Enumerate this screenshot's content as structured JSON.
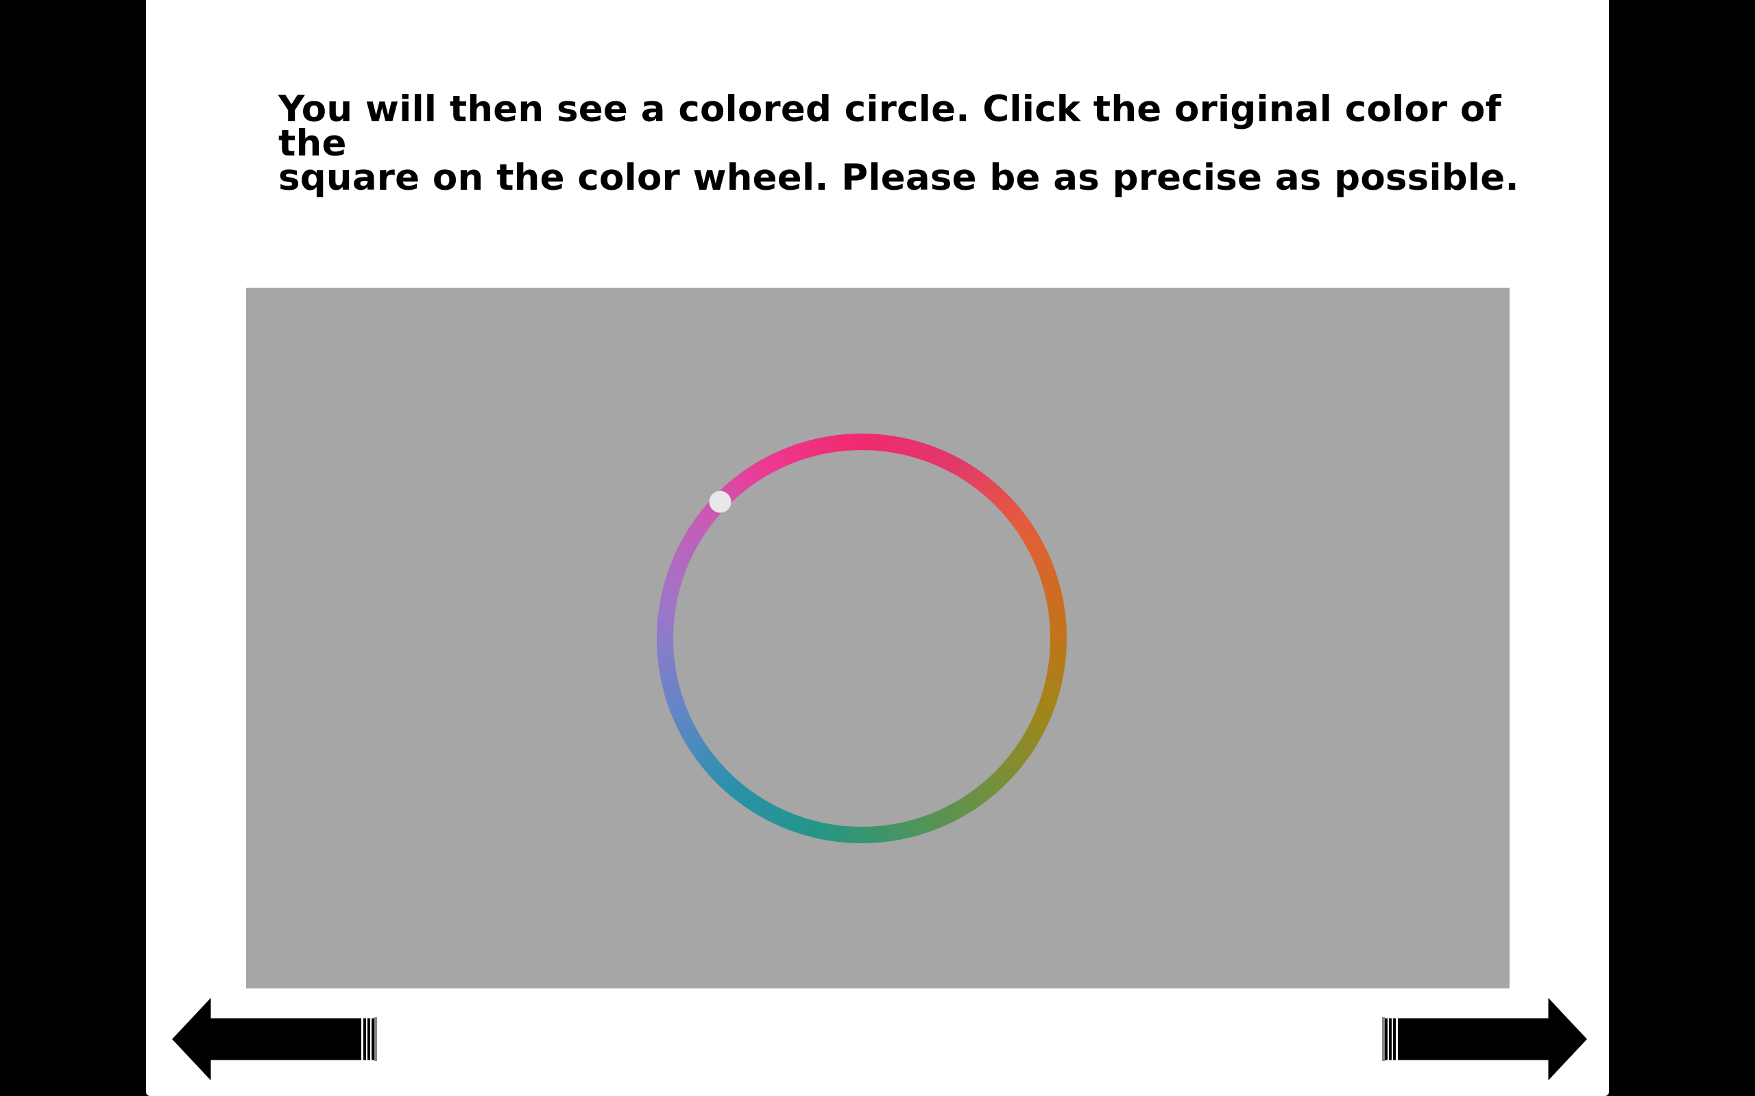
{
  "instructions": {
    "line1": "You will then see a colored circle. Click the original color of the",
    "line2": "square on the color wheel. Please be as precise as possible."
  },
  "stimulus": {
    "background_color": "#a6a6a6",
    "wheel_hue_stops": [
      "#f02a6e",
      "#e2396a",
      "#e45d3a",
      "#c9701c",
      "#a0861a",
      "#74903c",
      "#4a9460",
      "#249688",
      "#2b91ab",
      "#6485c8",
      "#9a78c9",
      "#c45eb8",
      "#ee3790",
      "#f02a6e"
    ],
    "marker_color": "#e8e8e8"
  },
  "navigation": {
    "previous_icon": "left-arrow-icon",
    "next_icon": "right-arrow-icon"
  }
}
